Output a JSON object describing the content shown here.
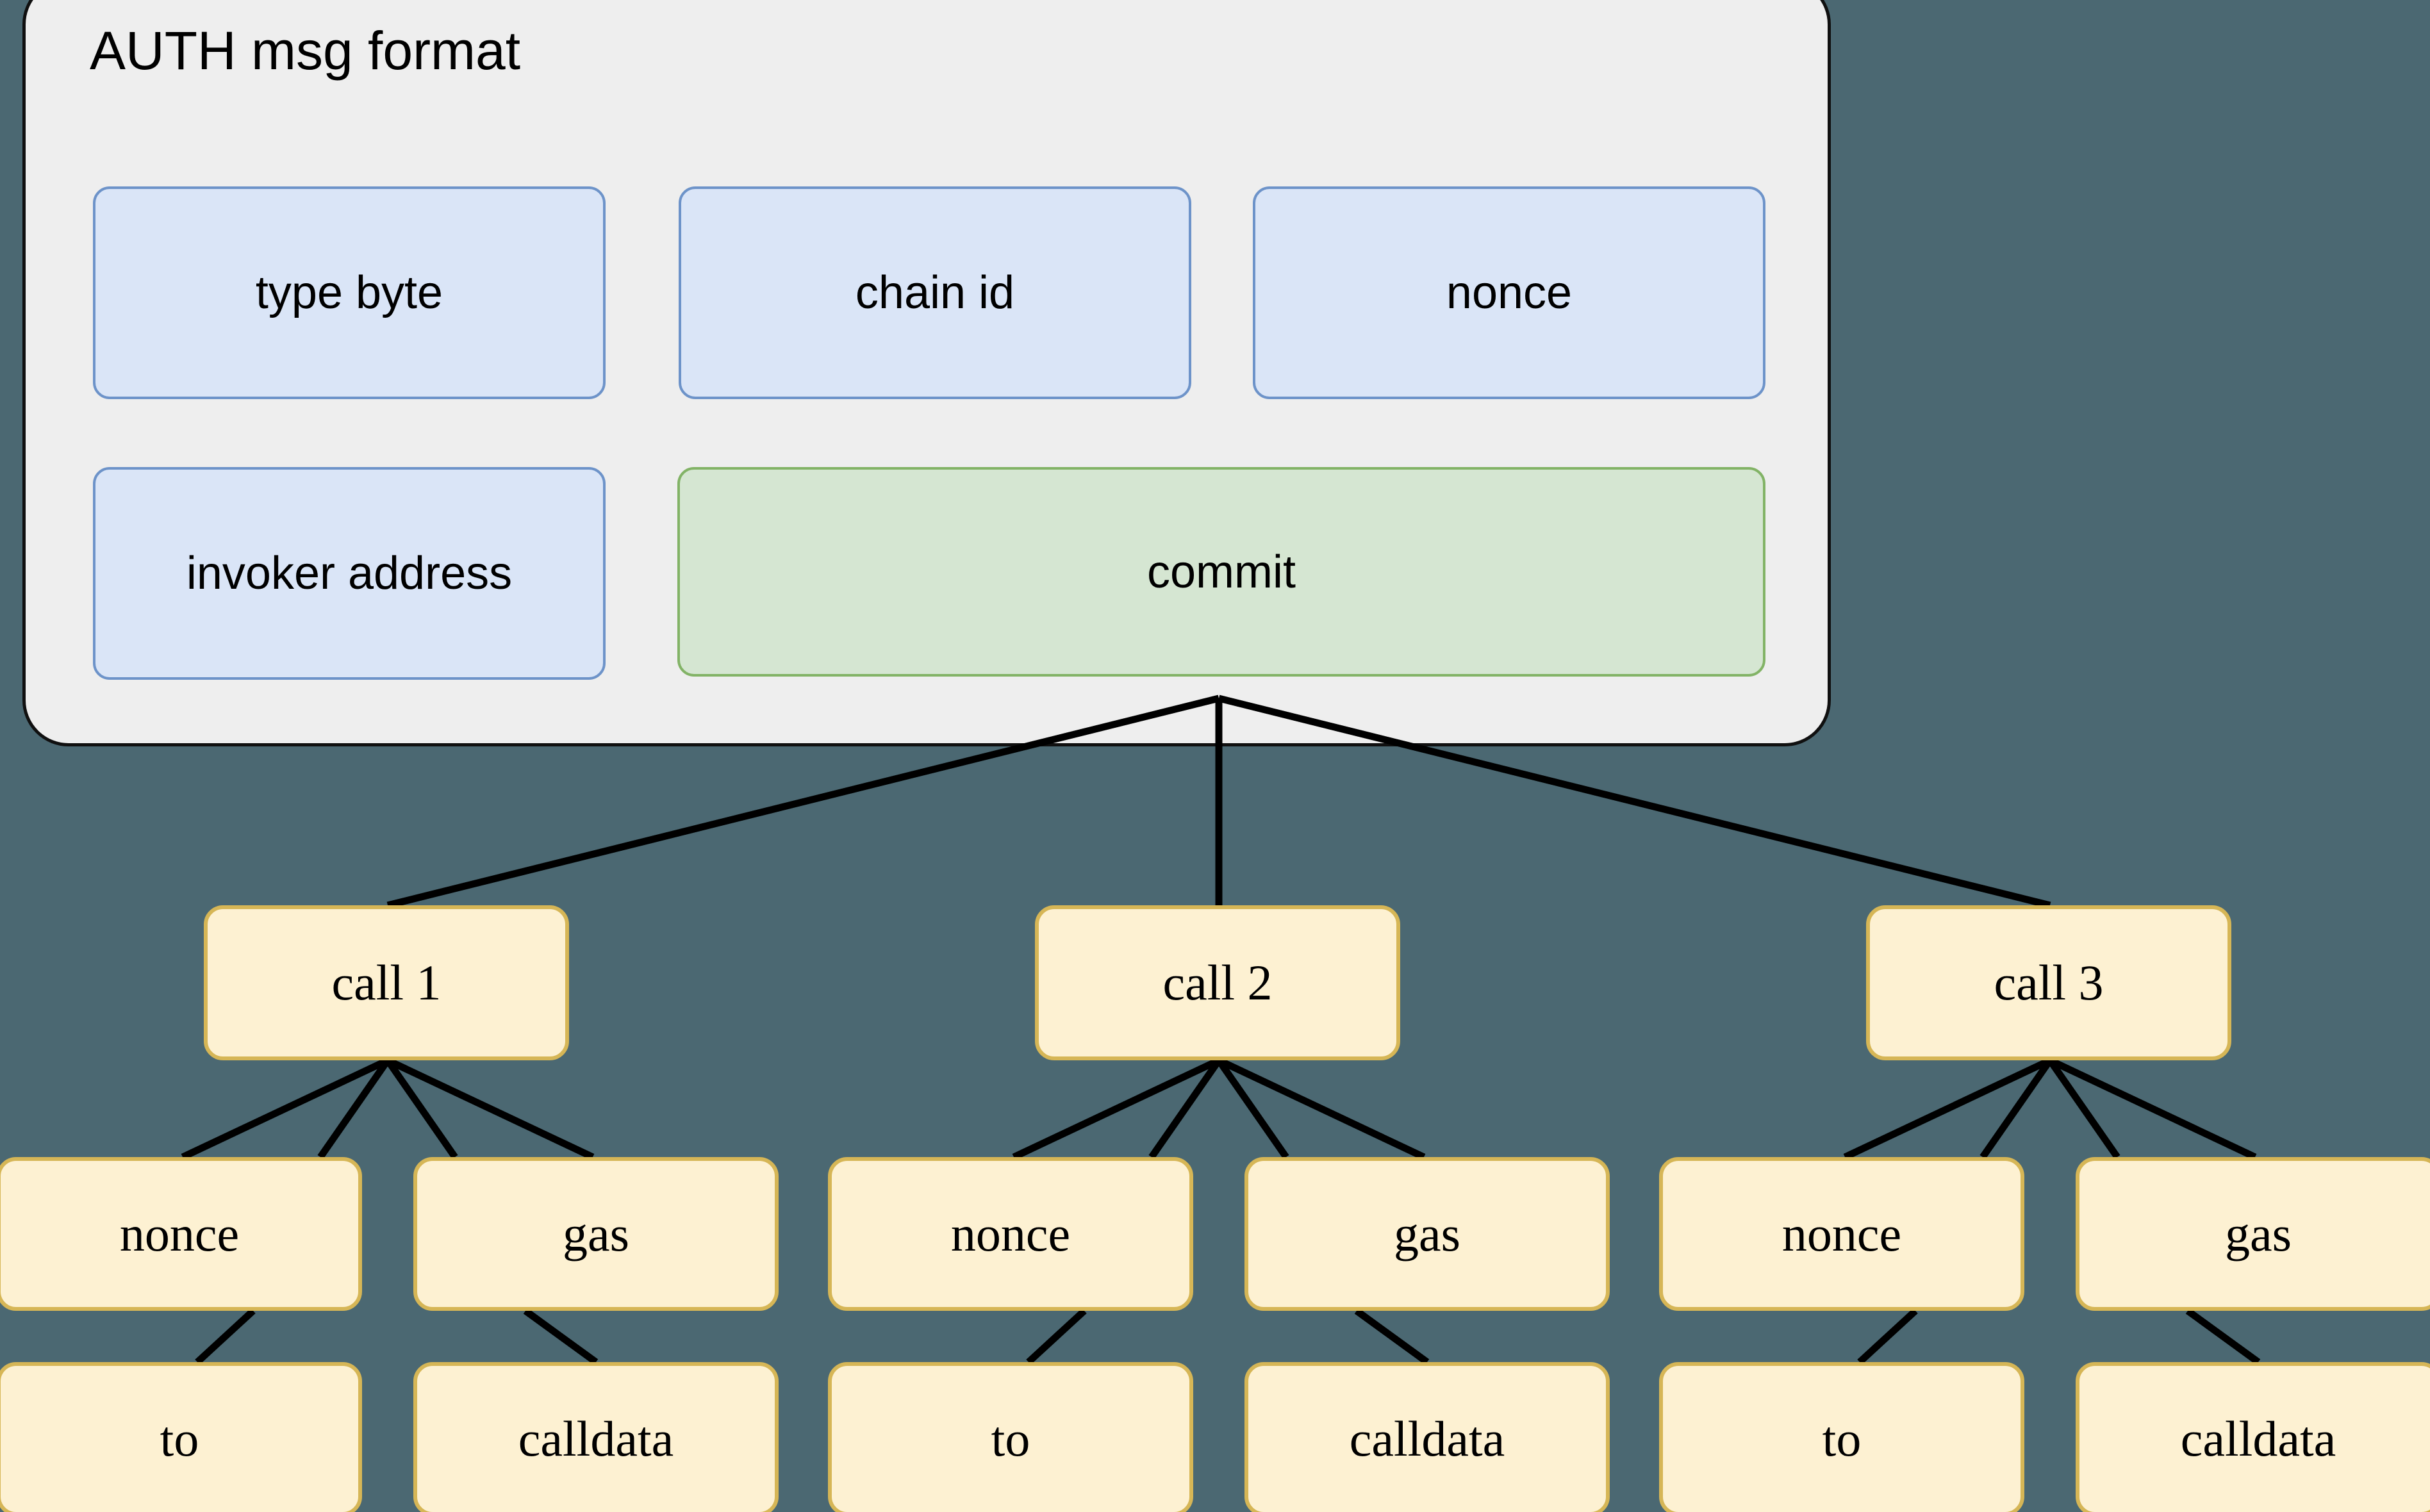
{
  "diagram": {
    "title": "AUTH msg format",
    "background_color": "#4b6872",
    "panel": {
      "label": "AUTH msg format",
      "fill": "#eeeeee",
      "stroke": "#101010",
      "fields": [
        {
          "label": "type byte",
          "kind": "blue"
        },
        {
          "label": "chain id",
          "kind": "blue"
        },
        {
          "label": "nonce",
          "kind": "blue"
        },
        {
          "label": "invoker address",
          "kind": "blue"
        },
        {
          "label": "commit",
          "kind": "green"
        }
      ]
    },
    "palette": {
      "blue_fill": "#dae5f7",
      "blue_stroke": "#6d93c9",
      "green_fill": "#d5e6d2",
      "green_stroke": "#82b366",
      "yellow_fill": "#fdf1d2",
      "yellow_stroke": "#d6b656",
      "edge_color": "#000000"
    },
    "tree": {
      "root_field": "commit",
      "calls": [
        {
          "label": "call 1",
          "children": [
            {
              "label": "nonce",
              "child": {
                "label": "to"
              }
            },
            {
              "label": "gas",
              "child": {
                "label": "calldata"
              }
            }
          ]
        },
        {
          "label": "call 2",
          "children": [
            {
              "label": "nonce",
              "child": {
                "label": "to"
              }
            },
            {
              "label": "gas",
              "child": {
                "label": "calldata"
              }
            }
          ]
        },
        {
          "label": "call 3",
          "children": [
            {
              "label": "nonce",
              "child": {
                "label": "to"
              }
            },
            {
              "label": "gas",
              "child": {
                "label": "calldata"
              }
            }
          ]
        }
      ]
    }
  }
}
